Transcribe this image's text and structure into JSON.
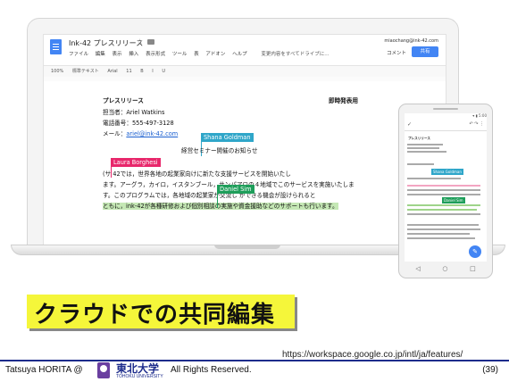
{
  "gdocs": {
    "title": "Ink-42 プレスリリース",
    "menu": [
      "ファイル",
      "編集",
      "表示",
      "挿入",
      "表示形式",
      "ツール",
      "表",
      "アドオン",
      "ヘルプ"
    ],
    "save_status": "変更内容をすべてドライブに...",
    "user_email": "miaochang@ink-42.com",
    "comment_label": "コメント",
    "share_label": "共有",
    "toolbar": [
      "100%",
      "標準テキスト",
      "Arial",
      "11",
      "B",
      "I",
      "U"
    ]
  },
  "document": {
    "heading": "プレスリリース",
    "release_note": "即時発表用",
    "contact_name": "担当者：Ariel Watkins",
    "phone": "電話番号：555-497-3128",
    "mail_label": "メール：",
    "mail_link": "ariel@ink-42.com",
    "subtitle": "経営セミナー開催のお知らせ",
    "para": [
      "(サ                          42では，世界各地の起業家向けに新たな支援サービスを開始いたし",
      "ます。アーグラ，カイロ，イスタンブール，サンパアロの４地域でこのサービスを実施いたしま",
      "す。このプログラムでは，各地域の起業家が交流し             ができる機会が設けられると",
      "ともに，ink-42が各種研修および個別相談の実施や資金援助などのサポートも行います。"
    ]
  },
  "collaborators": {
    "shana": {
      "name": "Shana Goldman",
      "color": "#2fa6c9"
    },
    "laura": {
      "name": "Laura Borghesi",
      "color": "#e8276b"
    },
    "daniel": {
      "name": "Daniel Sim",
      "color": "#1e9e5a"
    }
  },
  "phone": {
    "heading": "プレスリリース",
    "shana_label": "Shana Goldman",
    "daniel_label": "Daniel Sim"
  },
  "banner": {
    "text": "クラウドでの共同編集"
  },
  "source_url": "https://workspace.google.co.jp/intl/ja/features/",
  "footer": {
    "author": "Tatsuya HORITA @",
    "university": "東北大学",
    "university_en": "TOHOKU UNIVERSITY",
    "rights": "All Rights Reserved.",
    "page": "(39)"
  }
}
